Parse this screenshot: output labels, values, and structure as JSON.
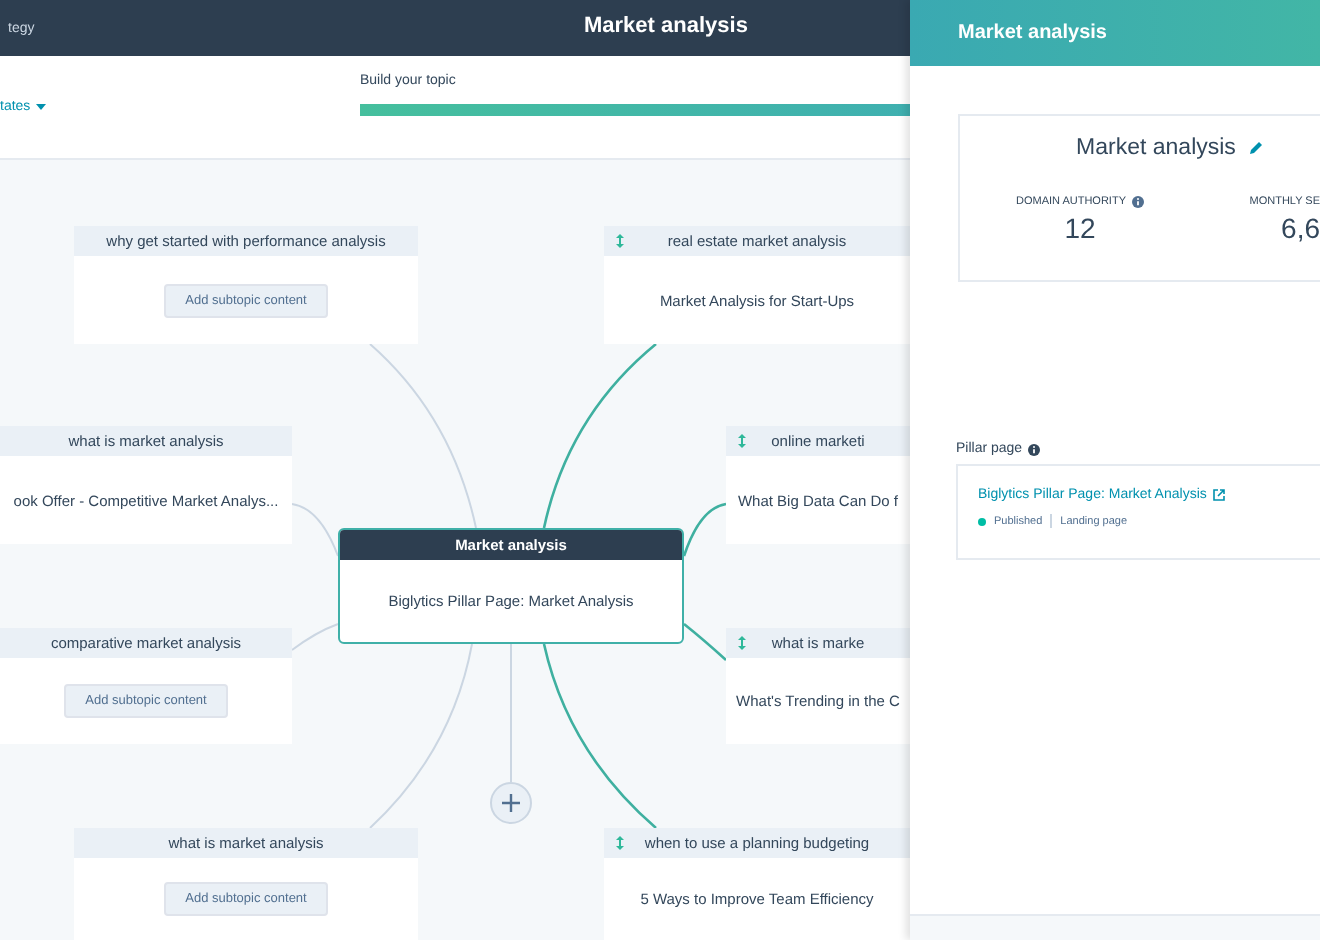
{
  "header": {
    "breadcrumb": "tegy",
    "title": "Market analysis"
  },
  "toolbar": {
    "dropdown": "tates",
    "progress": {
      "label": "Build your topic",
      "level": 1
    }
  },
  "map": {
    "core": {
      "title": "Market analysis",
      "page": "Biglytics Pillar Page: Market Analysis"
    },
    "subtopics": [
      {
        "title": "why get started with performance analysis",
        "kind": "empty",
        "button": "Add subtopic content",
        "linked": false
      },
      {
        "title": "what is market analysis",
        "kind": "content",
        "page": "ook Offer - Competitive Market Analys...",
        "linked": false
      },
      {
        "title": "comparative market analysis",
        "kind": "empty",
        "button": "Add subtopic content",
        "linked": false
      },
      {
        "title": "what is market analysis",
        "kind": "empty",
        "button": "Add subtopic content",
        "linked": false
      },
      {
        "title": "real estate market analysis",
        "kind": "content",
        "page": "Market Analysis for Start-Ups",
        "linked": true
      },
      {
        "title": "online marketi",
        "kind": "content",
        "page": "What Big Data Can Do f",
        "linked": true
      },
      {
        "title": "what is marke",
        "kind": "content",
        "page": "What's Trending in the C",
        "linked": true
      },
      {
        "title": "when to use a planning budgeting",
        "kind": "content",
        "page": "5 Ways to Improve Team Efficiency",
        "linked": true
      }
    ]
  },
  "panel": {
    "title": "Market analysis",
    "card": {
      "title": "Market analysis",
      "stats": [
        {
          "label": "DOMAIN AUTHORITY",
          "value": "12",
          "info": true
        },
        {
          "label": "MONTHLY SE",
          "value": "6,6",
          "info": false
        }
      ]
    },
    "pillar": {
      "label": "Pillar page",
      "link": "Biglytics Pillar Page: Market Analysis",
      "status": "Published",
      "type": "Landing page"
    }
  }
}
